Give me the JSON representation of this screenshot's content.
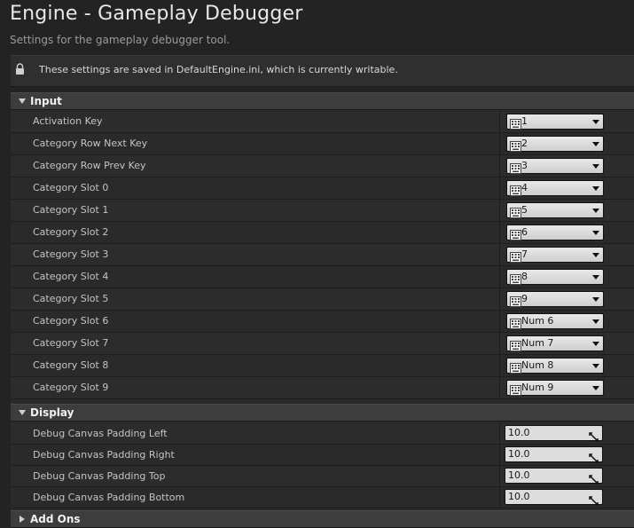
{
  "header": {
    "title": "Engine - Gameplay Debugger",
    "subtitle": "Settings for the gameplay debugger tool."
  },
  "notice": {
    "text": "These settings are saved in DefaultEngine.ini, which is currently writable.",
    "icon": "lock-icon"
  },
  "categories": {
    "input": {
      "label": "Input",
      "expanded": true
    },
    "display": {
      "label": "Display",
      "expanded": true
    },
    "add_ons": {
      "label": "Add Ons",
      "expanded": false
    }
  },
  "input_rows": [
    {
      "label": "Activation Key",
      "value": "1"
    },
    {
      "label": "Category Row Next Key",
      "value": "2"
    },
    {
      "label": "Category Row Prev Key",
      "value": "3"
    },
    {
      "label": "Category Slot 0",
      "value": "4"
    },
    {
      "label": "Category Slot 1",
      "value": "5"
    },
    {
      "label": "Category Slot 2",
      "value": "6"
    },
    {
      "label": "Category Slot 3",
      "value": "7"
    },
    {
      "label": "Category Slot 4",
      "value": "8"
    },
    {
      "label": "Category Slot 5",
      "value": "9"
    },
    {
      "label": "Category Slot 6",
      "value": "Num 6"
    },
    {
      "label": "Category Slot 7",
      "value": "Num 7"
    },
    {
      "label": "Category Slot 8",
      "value": "Num 8"
    },
    {
      "label": "Category Slot 9",
      "value": "Num 9"
    }
  ],
  "display_rows": [
    {
      "label": "Debug Canvas Padding Left",
      "value": "10.0"
    },
    {
      "label": "Debug Canvas Padding Right",
      "value": "10.0"
    },
    {
      "label": "Debug Canvas Padding Top",
      "value": "10.0"
    },
    {
      "label": "Debug Canvas Padding Bottom",
      "value": "10.0"
    }
  ]
}
